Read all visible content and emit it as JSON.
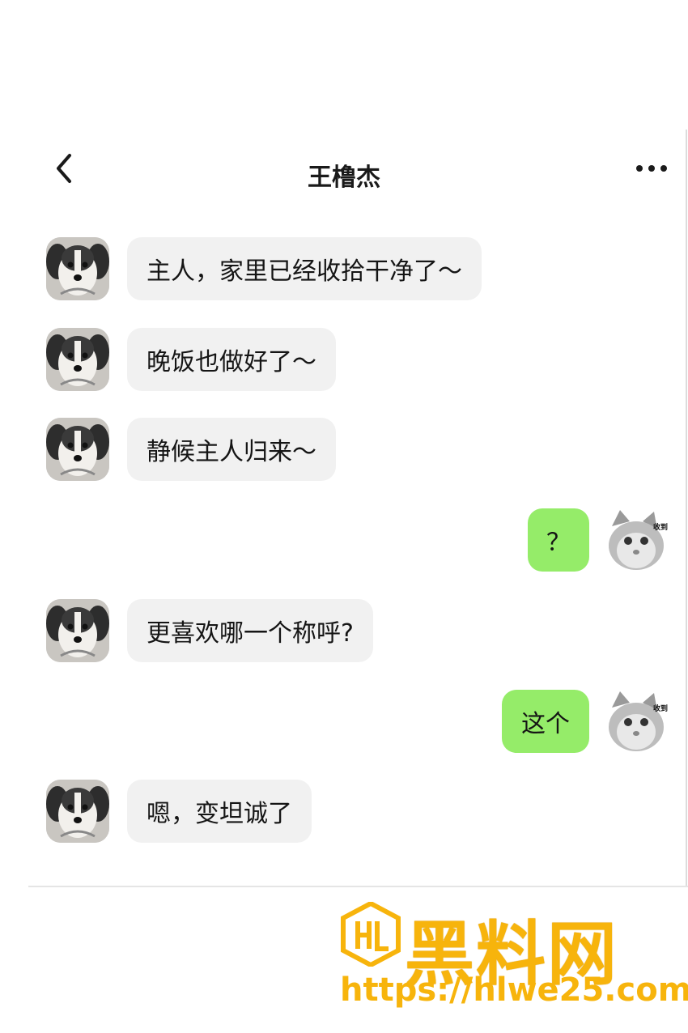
{
  "header": {
    "title": "王橹杰"
  },
  "colors": {
    "incoming_bubble": "#f1f1f1",
    "outgoing_bubble": "#95ec69",
    "watermark": "#f7b40c"
  },
  "icons": {
    "back": "chevron-left-icon",
    "more": "more-dots-icon"
  },
  "messages": [
    {
      "side": "in",
      "text": "主人，家里已经收拾干净了～"
    },
    {
      "side": "in",
      "text": "晚饭也做好了～"
    },
    {
      "side": "in",
      "text": "静候主人归来～"
    },
    {
      "side": "out",
      "text": "？",
      "sticker_label": "收到"
    },
    {
      "side": "in",
      "text": "更喜欢哪一个称呼?"
    },
    {
      "side": "out",
      "text": "这个",
      "sticker_label": "收到"
    },
    {
      "side": "in",
      "text": "嗯，变坦诚了"
    }
  ],
  "watermark": {
    "title": "黑料网",
    "url": "https://hlwe25.com"
  }
}
